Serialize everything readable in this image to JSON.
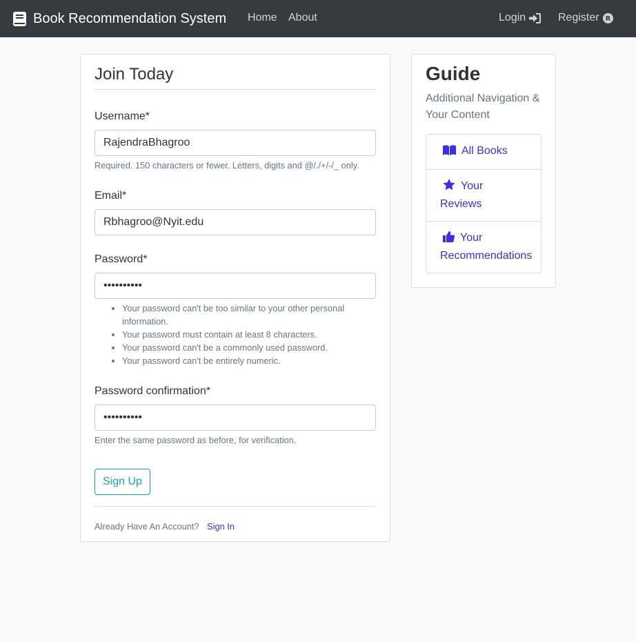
{
  "navbar": {
    "brand": "Book Recommendation System",
    "home": "Home",
    "about": "About",
    "login": "Login",
    "register": "Register"
  },
  "form": {
    "legend": "Join Today",
    "username_label": "Username*",
    "username_value": "RajendraBhagroo",
    "username_help": "Required. 150 characters or fewer. Letters, digits and @/./+/-/_ only.",
    "email_label": "Email*",
    "email_value": "Rbhagroo@Nyit.edu",
    "password_label": "Password*",
    "password_value": "••••••••••",
    "password_help": [
      "Your password can't be too similar to your other personal information.",
      "Your password must contain at least 8 characters.",
      "Your password can't be a commonly used password.",
      "Your password can't be entirely numeric."
    ],
    "confirm_label": "Password confirmation*",
    "confirm_value": "••••••••••",
    "confirm_help": "Enter the same password as before, for verification.",
    "submit": "Sign Up",
    "account_text": "Already Have An Account?",
    "signin_link": "Sign In"
  },
  "guide": {
    "title": "Guide",
    "subtitle": "Additional Navigation & Your Content",
    "items": [
      {
        "label": "All Books",
        "icon": "book-open-icon"
      },
      {
        "label": "Your Reviews",
        "icon": "star-icon"
      },
      {
        "label": "Your Recommendations",
        "icon": "thumbs-up-icon"
      }
    ]
  },
  "colors": {
    "navbar": "#343a40",
    "accent_link": "#3a2ee6",
    "button_outline": "#17a2b8"
  }
}
